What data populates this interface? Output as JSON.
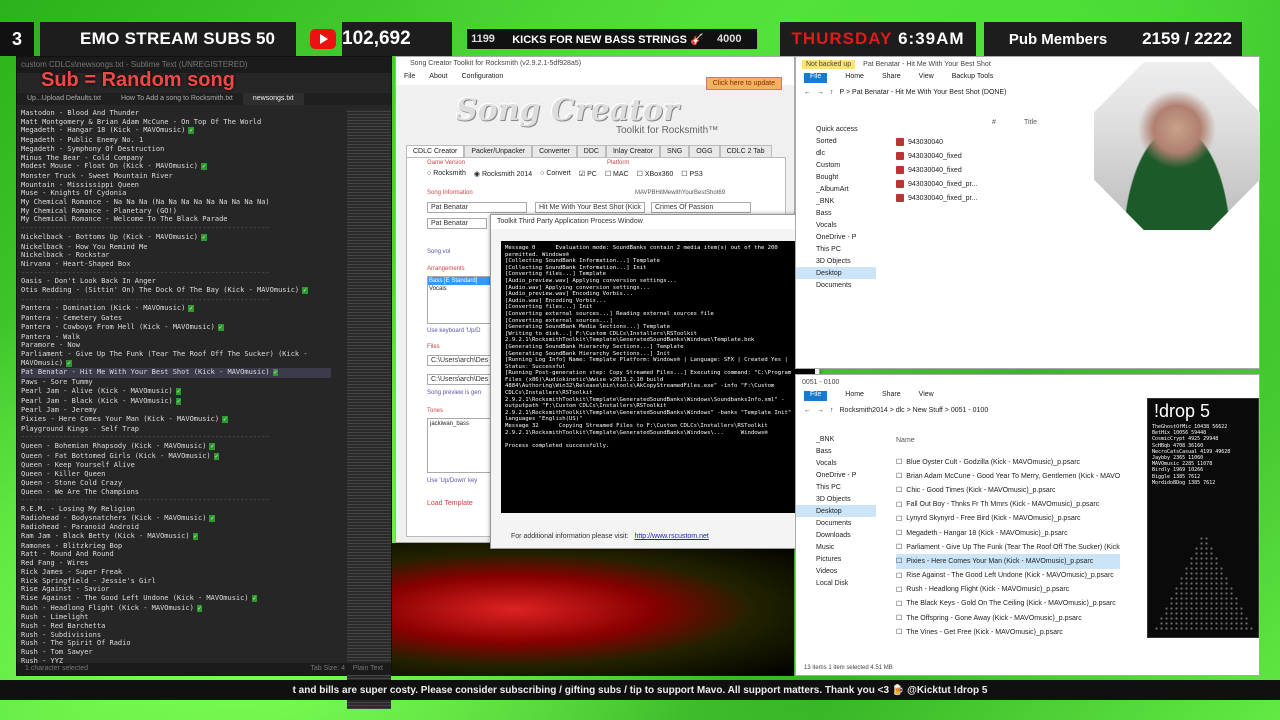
{
  "overlay": {
    "tier": "3",
    "subs_label": "EMO STREAM SUBS",
    "subs_count": "50",
    "views": "102,692",
    "goal_left": "1199",
    "goal_text": "KICKS FOR NEW BASS STRINGS 🎸",
    "goal_right": "4000",
    "day": "THURSDAY",
    "time": "6:39AM",
    "pub_label": "Pub Members",
    "pub_count": "2159 / 2222",
    "ticker": "t and bills are super costy. Please consider subscribing / gifting subs / tip to support Mavo. All support matters. Thank you <3 🍺 @Kicktut  !drop 5"
  },
  "sublime": {
    "title": "custom CDLCs\\newsongs.txt - Sublime Text (UNREGISTERED)",
    "banner": "Sub = Random song",
    "tabs": [
      "Up...Upload Defaults.txt",
      "How To Add a song to Rocksmith.txt",
      "newsongs.txt"
    ],
    "status_left": "1 character selected",
    "status_tab": "Tab Size: 4",
    "status_syntax": "Plain Text",
    "lines": [
      {
        "t": "Mastodon - Blood And Thunder"
      },
      {
        "t": "Matt Montgomery & Brian Adam McCune - On Top Of The World"
      },
      {
        "t": "Megadeth - Hangar 18 (Kick - MAVOmusic)",
        "c": true
      },
      {
        "t": "Megadeth - Public Enemy No. 1"
      },
      {
        "t": "Megadeth - Symphony Of Destruction"
      },
      {
        "t": "Minus The Bear - Cold Company"
      },
      {
        "t": "Modest Mouse - Float On (Kick - MAVOmusic)",
        "c": true
      },
      {
        "t": "Monster Truck - Sweet Mountain River"
      },
      {
        "t": "Mountain - Mississippi Queen"
      },
      {
        "t": "Muse - Knights Of Cydonia"
      },
      {
        "t": "My Chemical Romance - Na Na Na (Na Na Na Na Na Na Na Na Na)"
      },
      {
        "t": "My Chemical Romance - Planetary (GO!)"
      },
      {
        "t": "My Chemical Romance - Welcome To The Black Parade"
      },
      {
        "t": "-----------------------------------------------------------",
        "s": true
      },
      {
        "t": "Nickelback - Bottoms Up (Kick - MAVOmusic)",
        "c": true
      },
      {
        "t": "Nickelback - How You Remind Me"
      },
      {
        "t": "Nickelback - Rockstar"
      },
      {
        "t": "Nirvana - Heart-Shaped Box"
      },
      {
        "t": "-----------------------------------------------------------",
        "s": true
      },
      {
        "t": "Oasis - Don't Look Back In Anger"
      },
      {
        "t": "Otis Redding - (Sittin' On) The Dock Of The Bay (Kick - MAVOmusic)",
        "c": true
      },
      {
        "t": "-----------------------------------------------------------",
        "s": true
      },
      {
        "t": "Pantera - Domination (Kick - MAVOmusic)",
        "c": true
      },
      {
        "t": "Pantera - Cemetery Gates"
      },
      {
        "t": "Pantera - Cowboys From Hell (Kick - MAVOmusic)",
        "c": true
      },
      {
        "t": "Pantera - Walk"
      },
      {
        "t": "Paramore - Now"
      },
      {
        "t": "Parliament - Give Up The Funk (Tear The Roof Off The Sucker) (Kick -"
      },
      {
        "t": "MAVOmusic)",
        "c": true
      },
      {
        "t": "Pat Benatar - Hit Me With Your Best Shot (Kick - MAVOmusic)",
        "c": true,
        "h": true
      },
      {
        "t": "Paws - Sore Tummy"
      },
      {
        "t": "Pearl Jam - Alive (Kick - MAVOmusic)",
        "c": true
      },
      {
        "t": "Pearl Jam - Black (Kick - MAVOmusic)",
        "c": true
      },
      {
        "t": "Pearl Jam - Jeremy"
      },
      {
        "t": "Pixies - Here Comes Your Man (Kick - MAVOmusic)",
        "c": true
      },
      {
        "t": "Playground Kings - Self Trap"
      },
      {
        "t": "-----------------------------------------------------------",
        "s": true
      },
      {
        "t": "Queen - Bohemian Rhapsody (Kick - MAVOmusic)",
        "c": true
      },
      {
        "t": "Queen - Fat Bottomed Girls (Kick - MAVOmusic)",
        "c": true
      },
      {
        "t": "Queen - Keep Yourself Alive"
      },
      {
        "t": "Queen - Killer Queen"
      },
      {
        "t": "Queen - Stone Cold Crazy"
      },
      {
        "t": "Queen - We Are The Champions"
      },
      {
        "t": "-----------------------------------------------------------",
        "s": true
      },
      {
        "t": "R.E.M. - Losing My Religion"
      },
      {
        "t": "Radiohead - Bodysnatchers (Kick - MAVOmusic)",
        "c": true
      },
      {
        "t": "Radiohead - Paranoid Android"
      },
      {
        "t": "Ram Jam - Black Betty (Kick - MAVOmusic)",
        "c": true
      },
      {
        "t": "Ramones - Blitzkrieg Bop"
      },
      {
        "t": "Ratt - Round And Round"
      },
      {
        "t": "Red Fang - Wires"
      },
      {
        "t": "Rick James - Super Freak"
      },
      {
        "t": "Rick Springfield - Jessie's Girl"
      },
      {
        "t": "Rise Against - Savior"
      },
      {
        "t": "Rise Against - The Good Left Undone (Kick - MAVOmusic)",
        "c": true
      },
      {
        "t": "Rush - Headlong Flight (Kick - MAVOmusic)",
        "c": true
      },
      {
        "t": "Rush - Limelight"
      },
      {
        "t": "Rush - Red Barchetta"
      },
      {
        "t": "Rush - Subdivisions"
      },
      {
        "t": "Rush - The Spirit Of Radio"
      },
      {
        "t": "Rush - Tom Sawyer"
      },
      {
        "t": "Rush - YYZ"
      }
    ]
  },
  "songcreator": {
    "title": "Song Creator Toolkit for Rocksmith (v2.9.2.1-5df928a5)",
    "menu": [
      "File",
      "About",
      "Configuration"
    ],
    "update": "Click here to update",
    "logo": "Song Creator",
    "logo_sub": "Toolkit for Rocksmith™",
    "tabs": [
      "CDLC Creator",
      "Packer/Unpacker",
      "Converter",
      "DDC",
      "Inlay Creator",
      "SNG",
      "OGG",
      "CDLC 2 Tab"
    ],
    "game_version": "Game Version",
    "platform": "Platform",
    "rs1": "Rocksmith",
    "rs2014": "Rocksmith 2014",
    "convert": "Convert",
    "pc": "PC",
    "mac": "MAC",
    "xbox": "XBox360",
    "ps3": "PS3",
    "song_info": "Song Information",
    "artist": "Pat Benatar",
    "title_field": "Hit Me With Your Best Shot (Kick",
    "album": "Crimes Of Passion",
    "artist2": "Pat Benatar",
    "dlckey": "MAVPBHitMewithYourBestShot69",
    "arrangements": "Arrangements",
    "arr1": "Bass [E Standard]",
    "arr2": "Vocals",
    "files": "Files",
    "path1": "C:\\Users\\arch\\Des",
    "path2": "C:\\Users\\arch\\Des",
    "tones": "Tones",
    "tone1": "jackiwan_bass",
    "load": "Load Template",
    "keyboard": "Use keyboard 'Up/D",
    "updown": "Use 'Up/Down' key",
    "songvol": "Song vol",
    "preview": "Song preview is gen"
  },
  "process": {
    "title": "Toolkit Third Party Application Process Window",
    "log": "Message 0      Evaluation mode: SoundBanks contain 2 media item(s) out of the 200 permitted. Windows®\n[Collecting SoundBank Information...] Template\n[Collecting SoundBank Information...] Init\n[Converting files...] Template\n[Audio_preview.wav] Applying conversion settings...\n[Audio.wav] Applying conversion settings...\n[Audio_preview.wav] Encoding Vorbis...\n[Audio.wav] Encoding Vorbis...\n[Converting files...] Init\n[Converting external sources...] Reading external sources file\n[Converting external sources...]\n[Generating SoundBank Media Sections...] Template\n[Writing to disk...] F:\\Custom CDLCs\\Installers\\RSToolkit 2.9.2.1\\RocksmithToolkit\\Template\\GeneratedSoundBanks\\Windows\\Template.bnk\n[Generating SoundBank Hierarchy Sections...] Template\n[Generating SoundBank Hierarchy Sections...] Init\n[Running Log Info] Name: Template Platform: Windows® | Language: SFX | Created Yes | Status: Successful\n[Running Post-generation step: Copy Streamed Files...] Executing command: \"C:\\Program Files (x86)\\Audiokinetic\\Wwise v2013.2.10 build 4884\\Authoring\\Win32\\Release\\bin\\tools\\AkCopyStreamedFiles.exe\" -info \"F:\\Custom CDLCs\\Installers\\RSToolkit 2.9.2.1\\RocksmithToolkit\\Template\\GeneratedSoundBanks\\Windows\\SoundbanksInfo.xml\" -outputpath \"F:\\Custom CDLCs\\Installers\\RSToolkit 2.9.2.1\\RocksmithToolkit\\Template\\GeneratedSoundBanks\\Windows\" -banks \"Template Init\" -languages \"English(US)\"\nMessage 32      Copying Streamed Files to F:\\Custom CDLCs\\Installers\\RSToolkit 2.9.2.1\\RocksmithToolkit\\Template\\GeneratedSoundBanks\\Windows\\...     Windows®\n\nProcess completed successfully.",
    "footer": "For additional information please visit:",
    "link": "http://www.rscustom.net"
  },
  "explorer_top": {
    "warn": "Not backed up",
    "title": "Pat Benatar - Hit Me With Your Best Shot",
    "ribbon": [
      "File",
      "Home",
      "Share",
      "View",
      "Backup Tools"
    ],
    "path": "P > Pat Benatar - Hit Me With Your Best Shot (DONE)",
    "col_num": "#",
    "col_title": "Title",
    "nav": [
      "Quick access",
      "Sorted",
      "dlc",
      "Custom",
      "Bought",
      "_AlbumArt",
      "_BNK",
      "Bass",
      "Vocals",
      "OneDrive - P",
      "This PC",
      "3D Objects",
      "Desktop",
      "Documents"
    ],
    "files": [
      "943030040",
      "943030040_fixed",
      "943030040_fixed",
      "943030040_fixed_pr...",
      "943030040_fixed_pr..."
    ]
  },
  "explorer_bottom": {
    "title": "0051 - 0100",
    "ribbon": [
      "File",
      "Home",
      "Share",
      "View"
    ],
    "path": "Rocksmith2014 > dlc > New Stuff > 0051 - 0100",
    "col_name": "Name",
    "nav": [
      "_BNK",
      "Bass",
      "Vocals",
      "OneDrive - P",
      "This PC",
      "3D Objects",
      "Desktop",
      "Documents",
      "Downloads",
      "Music",
      "Pictures",
      "Videos",
      "Local Disk"
    ],
    "files": [
      "Blue Oyster Cult - Godzilla (Kick - MAVOmusic)_p.psarc",
      "Brian Adam McCune - Good Year To Merry, Gentlemen (Kick - MAVO",
      "Chic - Good Times (Kick - MAVOmusic)_p.psarc",
      "Fall Out Boy - Thnks Fr Th Mmrs (Kick - MAVOmusic)_p.psarc",
      "Lynyrd Skynyrd - Free Bird (Kick - MAVOmusic)_p.psarc",
      "Megadeth - Hangar 18 (Kick - MAVOmusic)_p.psarc",
      "Parliament - Give Up The Funk (Tear The Roof Off The Sucker) (Kick",
      "Pixies - Here Comes Your Man (Kick - MAVOmusic)_p.psarc",
      "Rise Against - The Good Left Undone (Kick - MAVOmusic)_p.psarc",
      "Rush - Headlong Flight (Kick - MAVOmusic)_p.psarc",
      "The Black Keys - Gold On The Ceiling (Kick - MAVOmusic)_p.psarc",
      "The Offspring - Gone Away (Kick - MAVOmusic)_p.psarc",
      "The Vines - Get Free (Kick - MAVOmusic)_p.psarc"
    ],
    "status": "13 items    1 item selected  4.51 MB"
  },
  "drop": {
    "title": "!drop 5",
    "rows": [
      "TheGhostOfMic  10438 56622",
      "BetHix  10056 59448",
      "CosmicCrypt  4925 29948",
      "ScHBqb  4708 36160",
      "NecroCatsCasual  4199 49628",
      "Jaybby  2365 11060",
      "MAVOmusic  2285 11078",
      "Birdly  1969 10266",
      "Biggle  1385 7612",
      "MordidoBDog  1385 7612"
    ]
  }
}
